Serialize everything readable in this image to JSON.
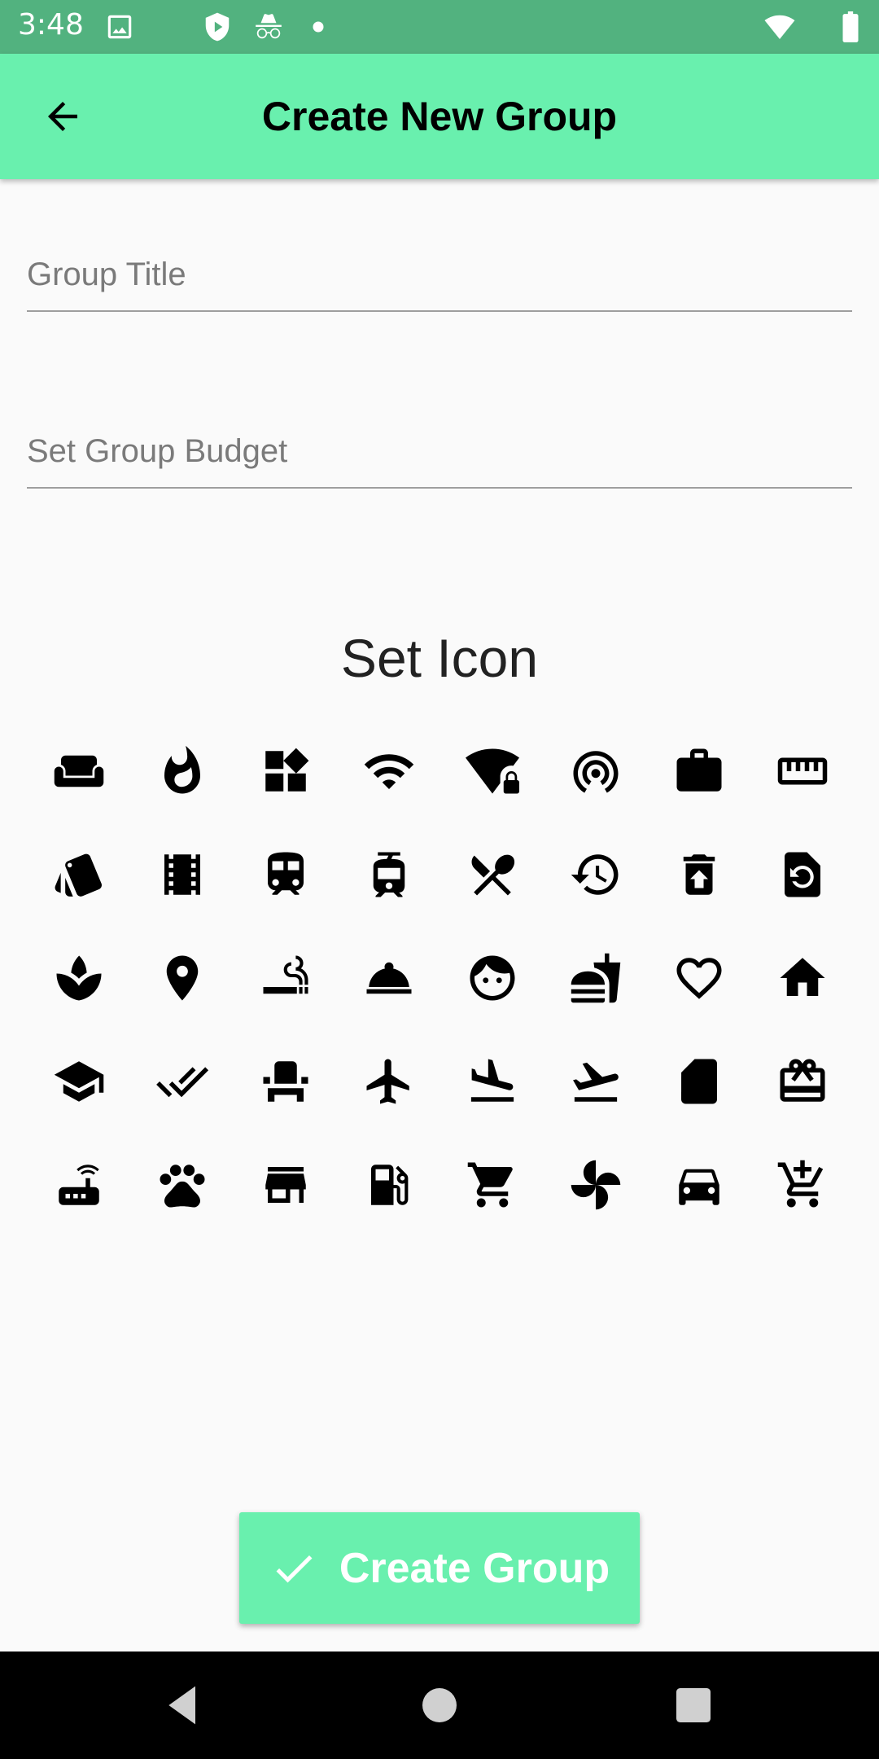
{
  "status_bar": {
    "time": "3:48",
    "icons": [
      "image-icon",
      "shield-play-icon",
      "incognito-icon",
      "dot-icon",
      "wifi-icon",
      "battery-icon"
    ]
  },
  "app_bar": {
    "back_icon": "arrow-back-icon",
    "title": "Create New Group"
  },
  "form": {
    "title_placeholder": "Group Title",
    "title_value": "",
    "budget_placeholder": "Set Group Budget",
    "budget_value": ""
  },
  "icon_picker": {
    "heading": "Set Icon",
    "icons": [
      "weekend-icon",
      "whatshot-icon",
      "widgets-icon",
      "wifi-icon",
      "wifi-lock-icon",
      "wifi-tethering-icon",
      "work-icon",
      "straighten-icon",
      "style-icon",
      "movie-icon",
      "train-icon",
      "tram-icon",
      "restaurant-icon",
      "restore-icon",
      "restore-from-trash-icon",
      "restore-page-icon",
      "spa-icon",
      "place-icon",
      "smoking-icon",
      "room-service-icon",
      "face-icon",
      "fastfood-icon",
      "favorite-border-icon",
      "home-icon",
      "school-icon",
      "done-all-icon",
      "event-seat-icon",
      "flight-icon",
      "flight-land-icon",
      "flight-takeoff-icon",
      "sd-card-icon",
      "card-giftcard-icon",
      "router-icon",
      "pets-icon",
      "store-icon",
      "local-gas-station-icon",
      "shopping-cart-icon",
      "toys-icon",
      "directions-car-icon",
      "add-shopping-cart-icon"
    ]
  },
  "actions": {
    "create_label": "Create Group",
    "create_icon": "check-icon"
  },
  "nav": {
    "icons": [
      "back-triangle-icon",
      "home-circle-icon",
      "recents-square-icon"
    ]
  },
  "colors": {
    "status_bar": "#52b27f",
    "accent": "#69f0ae",
    "background": "#fafafa"
  }
}
